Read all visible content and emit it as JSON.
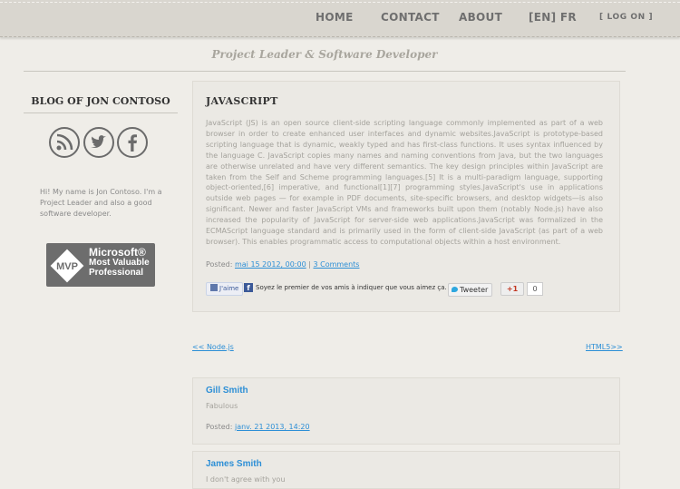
{
  "nav": {
    "home": "HOME",
    "contact": "CONTACT",
    "about": "ABOUT",
    "lang": "[EN]  FR",
    "logon": "[ LOG ON ]"
  },
  "subtitle": "Project Leader & Software Developer",
  "sidebar": {
    "blog_title": "BLOG OF JON CONTOSO",
    "icons": [
      "rss-icon",
      "twitter-icon",
      "facebook-icon"
    ],
    "about": "Hi! My name is Jon Contoso. I'm a Project Leader and also a good software developer.",
    "mvp": {
      "abbr": "MVP",
      "line1": "Microsoft®",
      "line2": "Most Valuable",
      "line3": "Professional"
    }
  },
  "article": {
    "title": "JAVASCRIPT",
    "body": "JavaScript (JS) is an open source client-side scripting language commonly implemented as part of a web browser in order to create enhanced user interfaces and dynamic websites.JavaScript is prototype-based scripting language that is dynamic, weakly typed and has first-class functions. It uses syntax influenced by the language C. JavaScript copies many names and naming conventions from Java, but the two languages are otherwise unrelated and have very different semantics. The key design principles within JavaScript are taken from the Self and Scheme programming languages.[5] It is a multi-paradigm language, supporting object-oriented,[6] imperative, and functional[1][7] programming styles.JavaScript's use in applications outside web pages — for example in PDF documents, site-specific browsers, and desktop widgets—is also significant. Newer and faster JavaScript VMs and frameworks built upon them (notably Node.js) have also increased the popularity of JavaScript for server-side web applications.JavaScript was formalized in the ECMAScript language standard and is primarily used in the form of client-side JavaScript (as part of a web browser). This enables programmatic access to computational objects within a host environment.",
    "posted_label": "Posted:",
    "posted_date": "mai 15 2012, 00:00",
    "separator": "|",
    "comments_link": "3 Comments",
    "social": {
      "fb_like": "J'aime",
      "fb_text": "Soyez le premier de vos amis à indiquer que vous aimez ça.",
      "tweet": "Tweeter",
      "gplus": "+1",
      "gplus_count": "0"
    }
  },
  "pager": {
    "prev": "<< Node.js",
    "next": "HTML5>>"
  },
  "comments": [
    {
      "author": "Gill Smith",
      "text": "Fabulous",
      "posted_label": "Posted:",
      "posted_date": "janv. 21 2013, 14:20"
    },
    {
      "author": "James Smith",
      "text": "I don't agree with you"
    }
  ],
  "colors": {
    "background": "#efede8",
    "link": "#2d8fd6",
    "topbar": "#d9d6cf"
  }
}
